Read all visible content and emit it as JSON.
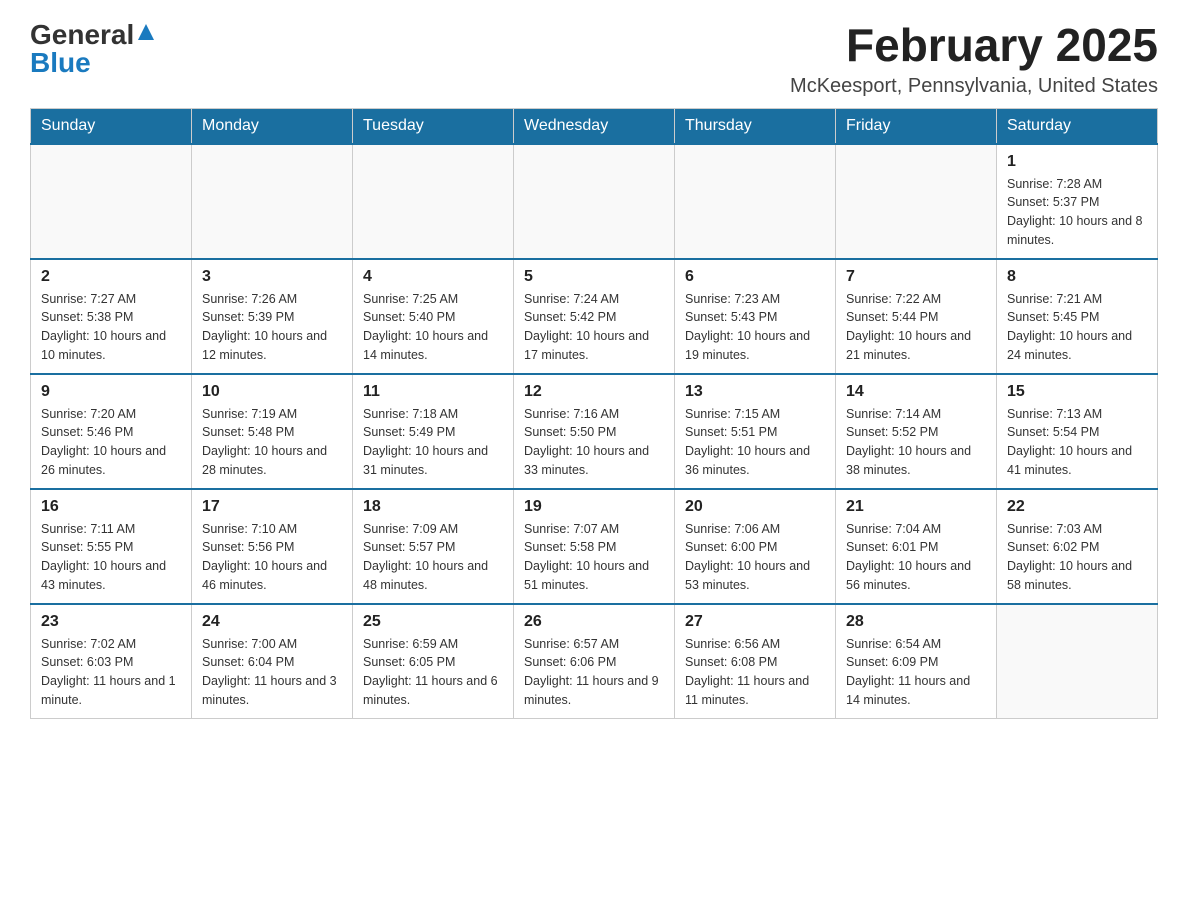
{
  "header": {
    "logo_general": "General",
    "logo_blue": "Blue",
    "month_title": "February 2025",
    "location": "McKeesport, Pennsylvania, United States"
  },
  "days_of_week": [
    "Sunday",
    "Monday",
    "Tuesday",
    "Wednesday",
    "Thursday",
    "Friday",
    "Saturday"
  ],
  "weeks": [
    [
      {
        "day": "",
        "info": ""
      },
      {
        "day": "",
        "info": ""
      },
      {
        "day": "",
        "info": ""
      },
      {
        "day": "",
        "info": ""
      },
      {
        "day": "",
        "info": ""
      },
      {
        "day": "",
        "info": ""
      },
      {
        "day": "1",
        "info": "Sunrise: 7:28 AM\nSunset: 5:37 PM\nDaylight: 10 hours and 8 minutes."
      }
    ],
    [
      {
        "day": "2",
        "info": "Sunrise: 7:27 AM\nSunset: 5:38 PM\nDaylight: 10 hours and 10 minutes."
      },
      {
        "day": "3",
        "info": "Sunrise: 7:26 AM\nSunset: 5:39 PM\nDaylight: 10 hours and 12 minutes."
      },
      {
        "day": "4",
        "info": "Sunrise: 7:25 AM\nSunset: 5:40 PM\nDaylight: 10 hours and 14 minutes."
      },
      {
        "day": "5",
        "info": "Sunrise: 7:24 AM\nSunset: 5:42 PM\nDaylight: 10 hours and 17 minutes."
      },
      {
        "day": "6",
        "info": "Sunrise: 7:23 AM\nSunset: 5:43 PM\nDaylight: 10 hours and 19 minutes."
      },
      {
        "day": "7",
        "info": "Sunrise: 7:22 AM\nSunset: 5:44 PM\nDaylight: 10 hours and 21 minutes."
      },
      {
        "day": "8",
        "info": "Sunrise: 7:21 AM\nSunset: 5:45 PM\nDaylight: 10 hours and 24 minutes."
      }
    ],
    [
      {
        "day": "9",
        "info": "Sunrise: 7:20 AM\nSunset: 5:46 PM\nDaylight: 10 hours and 26 minutes."
      },
      {
        "day": "10",
        "info": "Sunrise: 7:19 AM\nSunset: 5:48 PM\nDaylight: 10 hours and 28 minutes."
      },
      {
        "day": "11",
        "info": "Sunrise: 7:18 AM\nSunset: 5:49 PM\nDaylight: 10 hours and 31 minutes."
      },
      {
        "day": "12",
        "info": "Sunrise: 7:16 AM\nSunset: 5:50 PM\nDaylight: 10 hours and 33 minutes."
      },
      {
        "day": "13",
        "info": "Sunrise: 7:15 AM\nSunset: 5:51 PM\nDaylight: 10 hours and 36 minutes."
      },
      {
        "day": "14",
        "info": "Sunrise: 7:14 AM\nSunset: 5:52 PM\nDaylight: 10 hours and 38 minutes."
      },
      {
        "day": "15",
        "info": "Sunrise: 7:13 AM\nSunset: 5:54 PM\nDaylight: 10 hours and 41 minutes."
      }
    ],
    [
      {
        "day": "16",
        "info": "Sunrise: 7:11 AM\nSunset: 5:55 PM\nDaylight: 10 hours and 43 minutes."
      },
      {
        "day": "17",
        "info": "Sunrise: 7:10 AM\nSunset: 5:56 PM\nDaylight: 10 hours and 46 minutes."
      },
      {
        "day": "18",
        "info": "Sunrise: 7:09 AM\nSunset: 5:57 PM\nDaylight: 10 hours and 48 minutes."
      },
      {
        "day": "19",
        "info": "Sunrise: 7:07 AM\nSunset: 5:58 PM\nDaylight: 10 hours and 51 minutes."
      },
      {
        "day": "20",
        "info": "Sunrise: 7:06 AM\nSunset: 6:00 PM\nDaylight: 10 hours and 53 minutes."
      },
      {
        "day": "21",
        "info": "Sunrise: 7:04 AM\nSunset: 6:01 PM\nDaylight: 10 hours and 56 minutes."
      },
      {
        "day": "22",
        "info": "Sunrise: 7:03 AM\nSunset: 6:02 PM\nDaylight: 10 hours and 58 minutes."
      }
    ],
    [
      {
        "day": "23",
        "info": "Sunrise: 7:02 AM\nSunset: 6:03 PM\nDaylight: 11 hours and 1 minute."
      },
      {
        "day": "24",
        "info": "Sunrise: 7:00 AM\nSunset: 6:04 PM\nDaylight: 11 hours and 3 minutes."
      },
      {
        "day": "25",
        "info": "Sunrise: 6:59 AM\nSunset: 6:05 PM\nDaylight: 11 hours and 6 minutes."
      },
      {
        "day": "26",
        "info": "Sunrise: 6:57 AM\nSunset: 6:06 PM\nDaylight: 11 hours and 9 minutes."
      },
      {
        "day": "27",
        "info": "Sunrise: 6:56 AM\nSunset: 6:08 PM\nDaylight: 11 hours and 11 minutes."
      },
      {
        "day": "28",
        "info": "Sunrise: 6:54 AM\nSunset: 6:09 PM\nDaylight: 11 hours and 14 minutes."
      },
      {
        "day": "",
        "info": ""
      }
    ]
  ]
}
